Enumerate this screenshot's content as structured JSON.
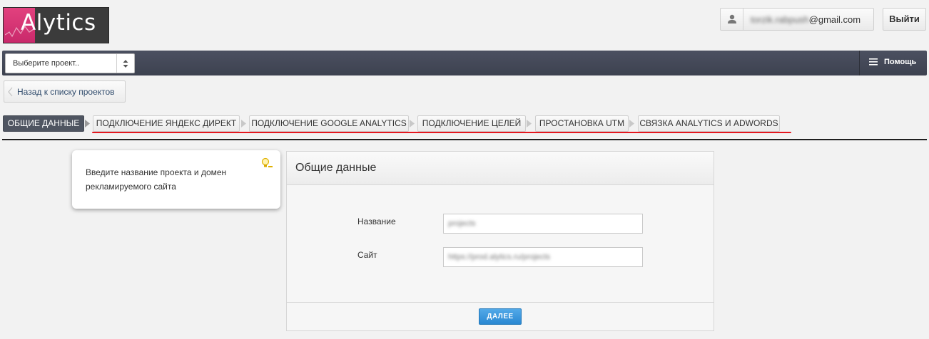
{
  "header": {
    "logo_text": "Alytics",
    "user_email_blurred": "torzik.rabpush",
    "user_email_domain": "@gmail.com",
    "logout_label": "Выйти"
  },
  "toolbar": {
    "project_select_value": "Выберите проект..",
    "help_label": "Помощь"
  },
  "back_button_label": "Назад к списку проектов",
  "tabs": [
    {
      "label": "ОБЩИЕ ДАННЫЕ",
      "active": true
    },
    {
      "label": "ПОДКЛЮЧЕНИЕ ЯНДЕКС ДИРЕКТ",
      "active": false
    },
    {
      "label": "ПОДКЛЮЧЕНИЕ GOOGLE ANALYTICS",
      "active": false
    },
    {
      "label": "ПОДКЛЮЧЕНИЕ ЦЕЛЕЙ",
      "active": false
    },
    {
      "label": "ПРОСТАНОВКА UTM",
      "active": false
    },
    {
      "label": "СВЯЗКА ANALYTICS И ADWORDS",
      "active": false
    }
  ],
  "hint": {
    "text": "Введите название проекта и домен рекламируемого сайта"
  },
  "form": {
    "title": "Общие данные",
    "name_label": "Название",
    "name_value": "projects",
    "site_label": "Сайт",
    "site_value": "https://prod.alytics.ru/projects",
    "next_label": "ДАЛЕЕ"
  },
  "colors": {
    "toolbar": "#454a58",
    "active_tab": "#4f5561",
    "underline_annotation": "#e4171e",
    "primary_button": "#3a97dd",
    "logo_accent": "#d6316f"
  }
}
